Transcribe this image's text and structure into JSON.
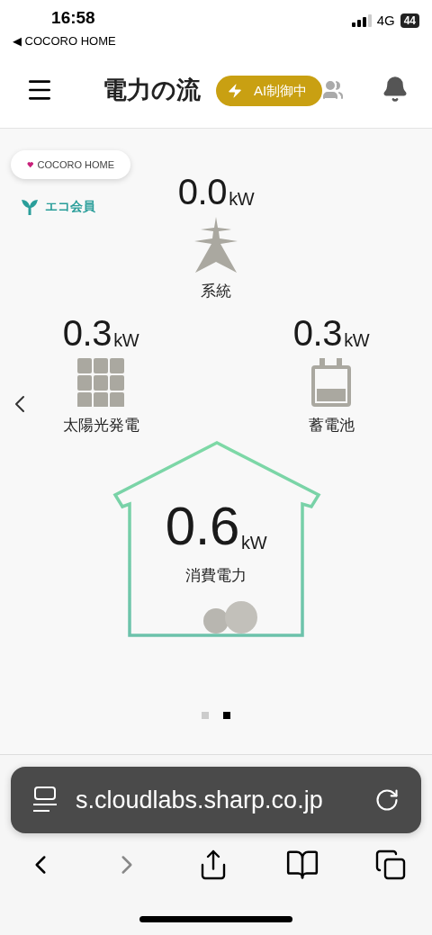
{
  "status_bar": {
    "time": "16:58",
    "back_app": "◀ COCORO HOME",
    "network": "4G",
    "battery": "44"
  },
  "header": {
    "title": "電力の流",
    "badge": "AI制御中"
  },
  "brand": {
    "logo_text": "COCORO HOME",
    "membership": "エコ会員"
  },
  "nodes": [
    {
      "kind": "grid",
      "value": "0.0",
      "unit": "kW",
      "label": "系統"
    },
    {
      "kind": "solar",
      "value": "0.3",
      "unit": "kW",
      "label": "太陽光発電"
    },
    {
      "kind": "battery",
      "value": "0.3",
      "unit": "kW",
      "label": "蓄電池"
    },
    {
      "kind": "home",
      "value": "0.6",
      "unit": "kW",
      "label": "消費電力"
    }
  ],
  "pages": [
    {
      "selected": false
    },
    {
      "selected": true
    }
  ],
  "browser": {
    "url": "s.cloudlabs.sharp.co.jp"
  }
}
